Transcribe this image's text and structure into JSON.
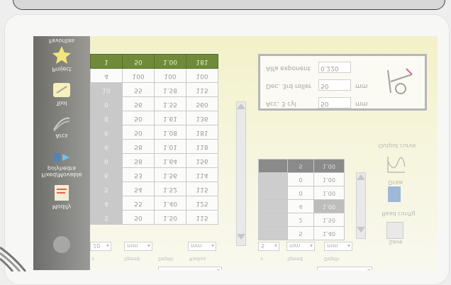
{
  "toolbar": {
    "items": [
      {
        "label": "Favorites",
        "icon": "star-icon"
      },
      {
        "label": "Project",
        "icon": "star-icon"
      },
      {
        "label": "Tool",
        "icon": "pen-icon"
      },
      {
        "label": "Arcs",
        "icon": "arcs-icon"
      },
      {
        "label": "Fixed/Movable polyhedra",
        "icon": "connect-icon"
      },
      {
        "label": "Modify",
        "icon": "clipboard-icon"
      }
    ]
  },
  "table": {
    "header": [
      "1",
      "50",
      "1.00",
      "181"
    ],
    "rows": [
      [
        "4",
        "100",
        "100",
        "100"
      ],
      [
        "10",
        "55",
        "1.58",
        "115"
      ],
      [
        "0",
        "56",
        "1.55",
        "560"
      ],
      [
        "8",
        "50",
        "1.61",
        "136"
      ],
      [
        "6",
        "50",
        "1.08",
        "181"
      ],
      [
        "6",
        "58",
        "1.01",
        "118"
      ],
      [
        "6",
        "58",
        "1.64",
        "156"
      ],
      [
        "6",
        "53",
        "1.56",
        "114"
      ],
      [
        "5",
        "54",
        "1.52",
        "115"
      ],
      [
        "4",
        "55",
        "1.40",
        "125"
      ],
      [
        "5",
        "50",
        "1.50",
        "115"
      ]
    ],
    "footer_select_1": "20",
    "footer_select_2": "mm",
    "footer_select_3": "mm",
    "footer_labels": [
      "v",
      "Speed",
      "Depth",
      "Radius"
    ]
  },
  "settings": {
    "rows": [
      {
        "label": "Alfa exponent",
        "value": "0.220",
        "unit": ""
      },
      {
        "label": "Dec. 3rd roller",
        "value": "50",
        "unit": "mm"
      },
      {
        "label": "Acc. 3 cyl",
        "value": "50",
        "unit": "mm"
      }
    ]
  },
  "small_table": {
    "header": [
      "",
      "5",
      "1.00"
    ],
    "rows": [
      [
        "",
        "0",
        "1.00"
      ],
      [
        "",
        "0",
        "1.00"
      ],
      [
        "",
        "4",
        "1.00"
      ],
      [
        "",
        "2",
        "1.50"
      ],
      [
        "",
        "5",
        "1.40"
      ]
    ],
    "footer_select_1": "5",
    "footer_select_2": "mm",
    "footer_select_3": "mm",
    "footer_labels": [
      "v",
      "Speed",
      "Depth"
    ]
  },
  "right_panel": {
    "title": "Output curve",
    "item_1": "Draw",
    "item_2": "Read config",
    "item_3": "Save"
  },
  "colors": {
    "table_header": "#6f8b3a",
    "toolbar": "#707070",
    "star": "#f1e36a"
  }
}
